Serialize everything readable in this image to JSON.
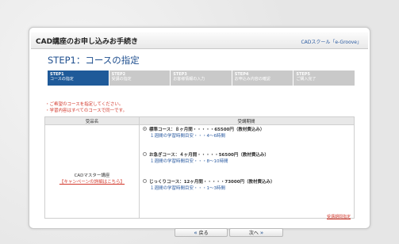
{
  "header": {
    "title": "CAD講座のお申し込みお手続き",
    "brand": "CADスクール「e-Groove」"
  },
  "page": {
    "heading": "STEP1：コースの指定"
  },
  "steps": [
    {
      "num": "STEP1",
      "label": "コースの指定"
    },
    {
      "num": "STEP2",
      "label": "受講の指定"
    },
    {
      "num": "STEP3",
      "label": "お客様情報の入力"
    },
    {
      "num": "STEP4",
      "label": "お申込み内容の確認"
    },
    {
      "num": "STEP5",
      "label": "ご購入完了"
    }
  ],
  "notes": {
    "line1": "・ご希望のコースを指定してください。",
    "line2": "・学習内容はすべてのコースで同一です。"
  },
  "table": {
    "col_product": "受品名",
    "col_period": "受講期間",
    "product_name": "CADマスター講座",
    "campaign_link": "【キャンペーンの詳細はこちら】",
    "period_link": "受講期間指定"
  },
  "courses": [
    {
      "title": "標準コース：８ヶ月間・・・・・65500円（教材費込み）",
      "sub": "１週間の学習時間目安・・・4～6時間",
      "selected": true
    },
    {
      "title": "お急ぎコース：４ヶ月間・・・・・56500円（教材費込み）",
      "sub": "１週間の学習時間目安・・・8～10時間",
      "selected": false
    },
    {
      "title": "じっくりコース：12ヶ月間・・・・・73000円（教材費込み）",
      "sub": "１週間の学習時間目安・・・1～3時間",
      "selected": false
    }
  ],
  "buttons": {
    "back": "戻る",
    "next": "次へ"
  },
  "icons": {
    "back": "double-left-arrow-icon",
    "next": "double-right-arrow-icon"
  }
}
